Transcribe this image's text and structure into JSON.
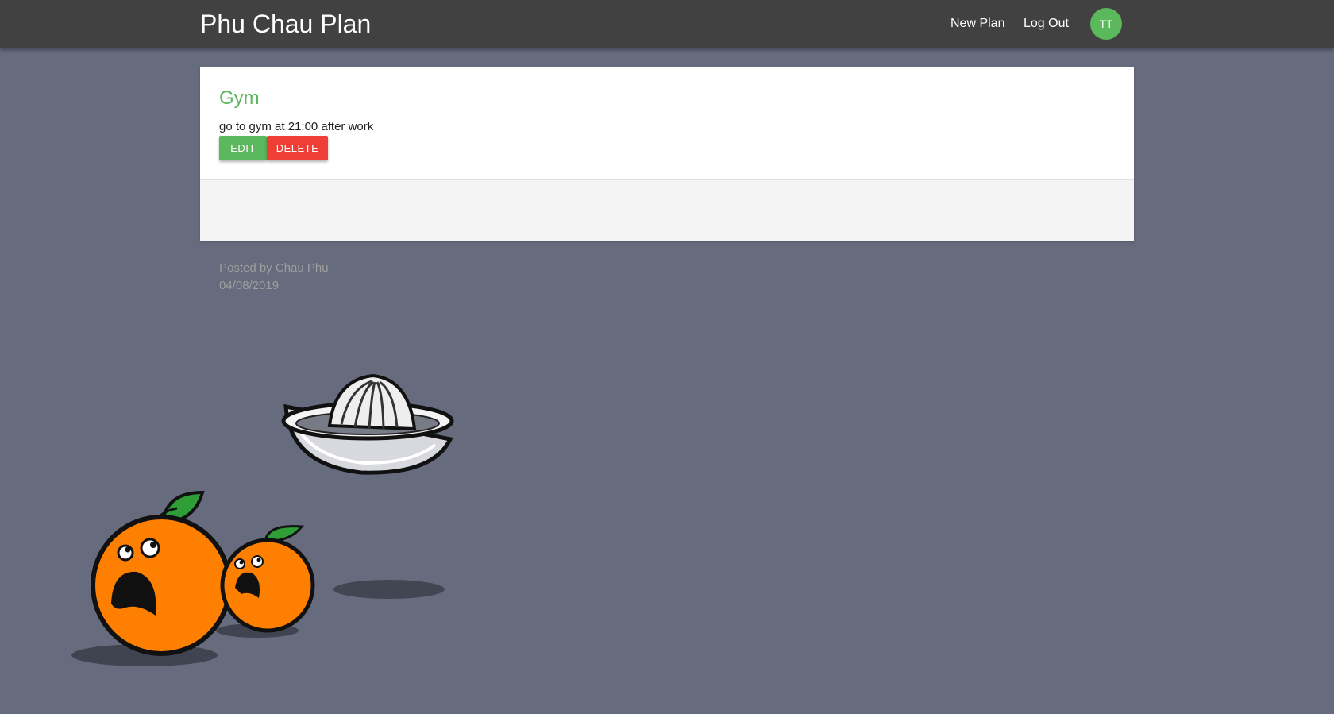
{
  "navbar": {
    "brand": "Phu Chau Plan",
    "links": [
      "New Plan",
      "Log Out"
    ],
    "avatar_initials": "TT",
    "background": "#414141"
  },
  "plan": {
    "title": "Gym",
    "description": "go to gym at 21:00 after work",
    "edit_label": "EDIT",
    "delete_label": "DELETE",
    "posted_by": "Posted by Chau Phu",
    "date": "04/08/2019"
  },
  "colors": {
    "accent": "#5cb85c",
    "danger": "#ef3e36",
    "page_background": "#666b7e"
  },
  "illustration": {
    "items": [
      "juicer-icon",
      "scared-orange-large-icon",
      "scared-orange-small-icon"
    ]
  }
}
